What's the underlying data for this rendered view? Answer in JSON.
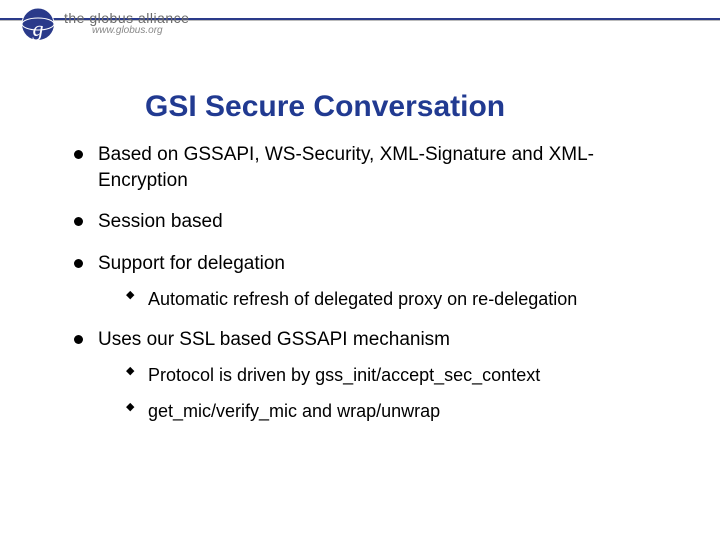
{
  "brand": {
    "name": "the globus alliance",
    "url": "www.globus.org",
    "accent": "#2a3a8a"
  },
  "slide": {
    "title": "GSI Secure Conversation",
    "bullets": [
      {
        "text": "Based on GSSAPI, WS-Security, XML-Signature and XML-Encryption",
        "children": []
      },
      {
        "text": "Session based",
        "children": []
      },
      {
        "text": "Support for delegation",
        "children": [
          "Automatic refresh of delegated proxy on re-delegation"
        ]
      },
      {
        "text": "Uses our SSL based GSSAPI mechanism",
        "children": [
          "Protocol is driven by gss_init/accept_sec_context",
          "get_mic/verify_mic and wrap/unwrap"
        ]
      }
    ]
  }
}
